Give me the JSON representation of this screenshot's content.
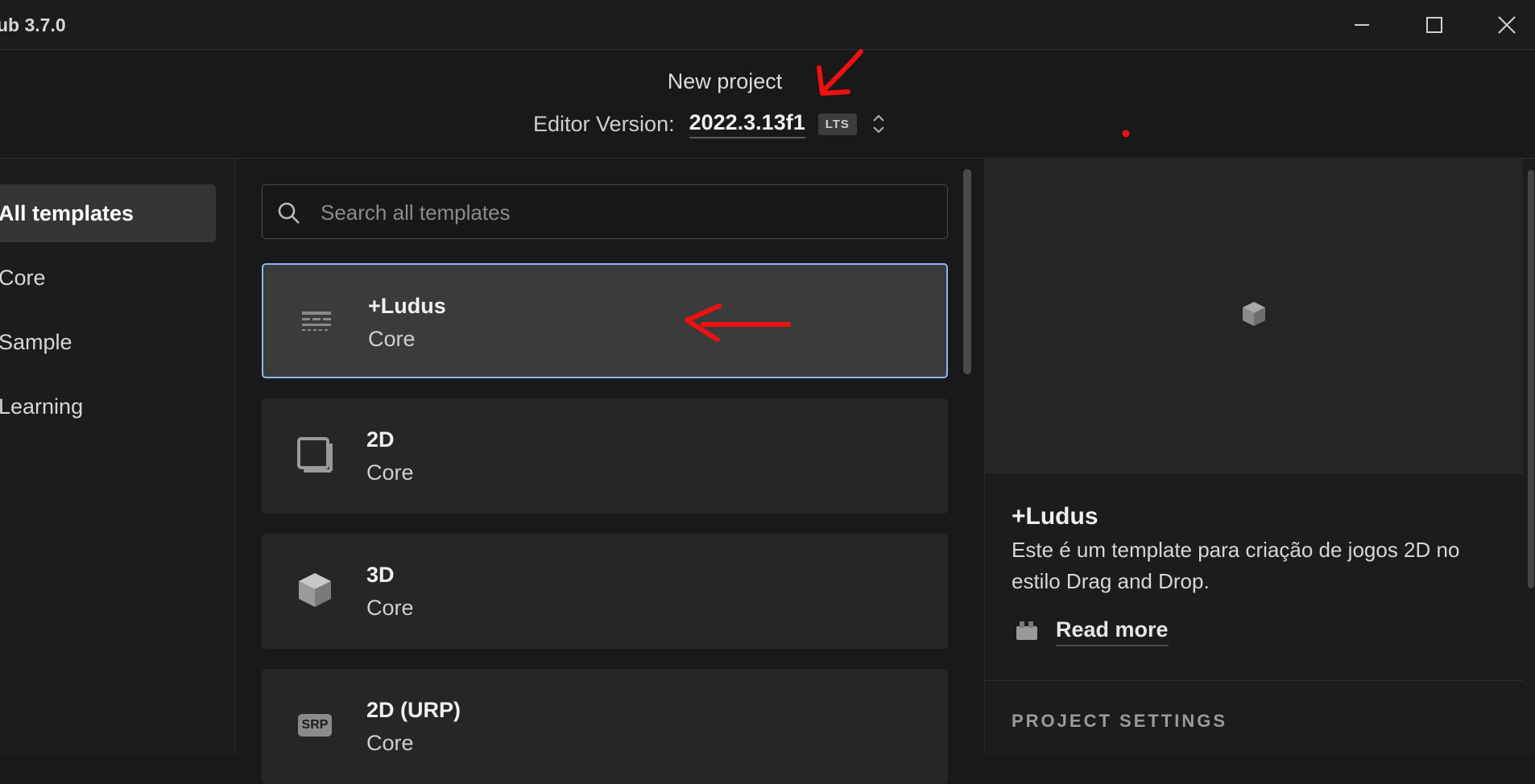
{
  "window": {
    "title": "ub 3.7.0"
  },
  "header": {
    "title": "New project",
    "editor_version_label": "Editor Version:",
    "editor_version_value": "2022.3.13f1",
    "lts_badge": "LTS"
  },
  "sidebar": {
    "items": [
      {
        "label": "All templates",
        "active": true
      },
      {
        "label": "Core"
      },
      {
        "label": "Sample"
      },
      {
        "label": "Learning"
      }
    ]
  },
  "search": {
    "placeholder": "Search all templates"
  },
  "templates": [
    {
      "name": "+Ludus",
      "category": "Core",
      "icon": "list-lines-icon",
      "selected": true
    },
    {
      "name": "2D",
      "category": "Core",
      "icon": "square-2d-icon"
    },
    {
      "name": "3D",
      "category": "Core",
      "icon": "cube-3d-icon"
    },
    {
      "name": "2D (URP)",
      "category": "Core",
      "icon": "srp-badge-icon",
      "icon_text": "SRP"
    }
  ],
  "detail": {
    "name": "+Ludus",
    "description": "Este é um template para criação de jogos 2D no estilo Drag and Drop.",
    "read_more": "Read more",
    "project_settings_label": "PROJECT SETTINGS"
  },
  "colors": {
    "background": "#191919",
    "selected_border": "#8ab4f8",
    "annotation": "#ee1111"
  }
}
